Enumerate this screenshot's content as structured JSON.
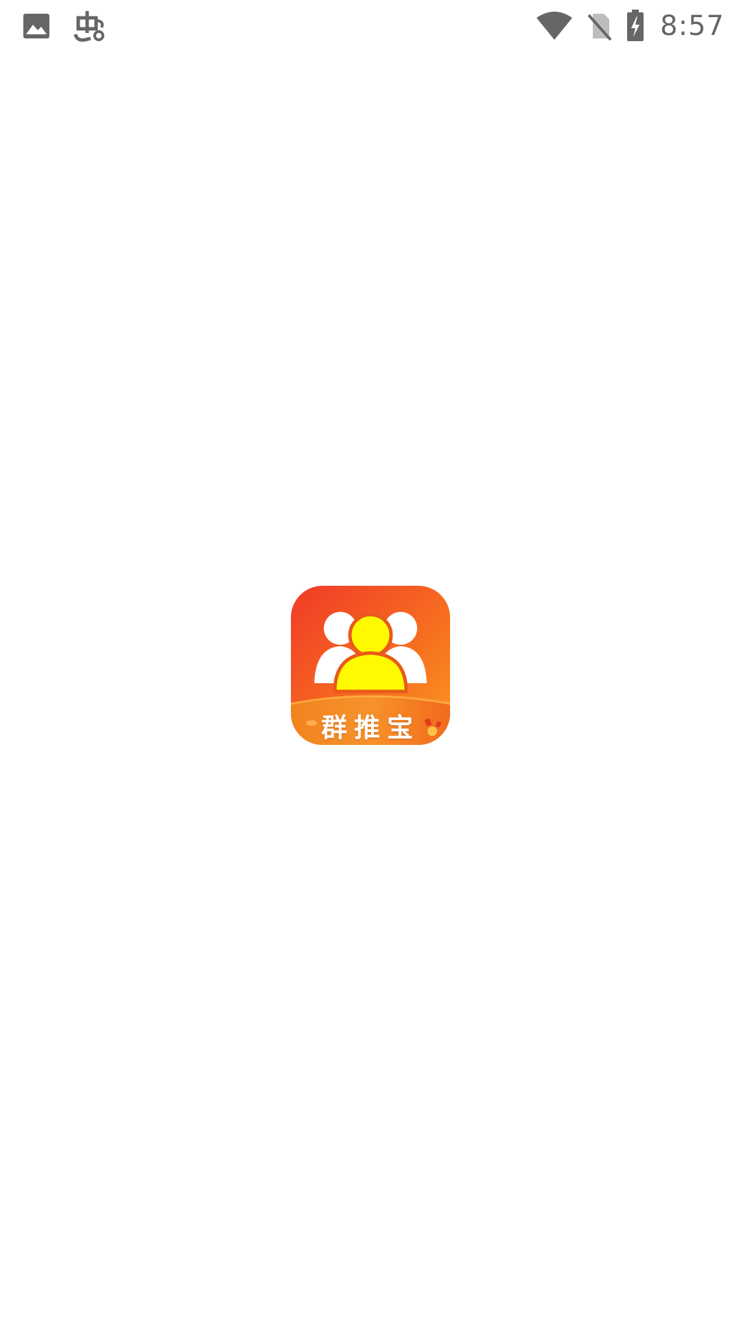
{
  "status_bar": {
    "time": "8:57",
    "left_icons": [
      "gallery-icon",
      "bug-icon"
    ],
    "right_icons": [
      "wifi-icon",
      "no-sim-icon",
      "battery-charging-icon"
    ],
    "icon_color": "#666666"
  },
  "splash": {
    "logo_label": "群推宝",
    "logo_icon": "group-people-icon",
    "colors": {
      "gradient_top": "#f03a28",
      "gradient_bottom": "#fb9a22",
      "head_fill": "#fffa00",
      "head_outline": "#e85a1a"
    }
  }
}
